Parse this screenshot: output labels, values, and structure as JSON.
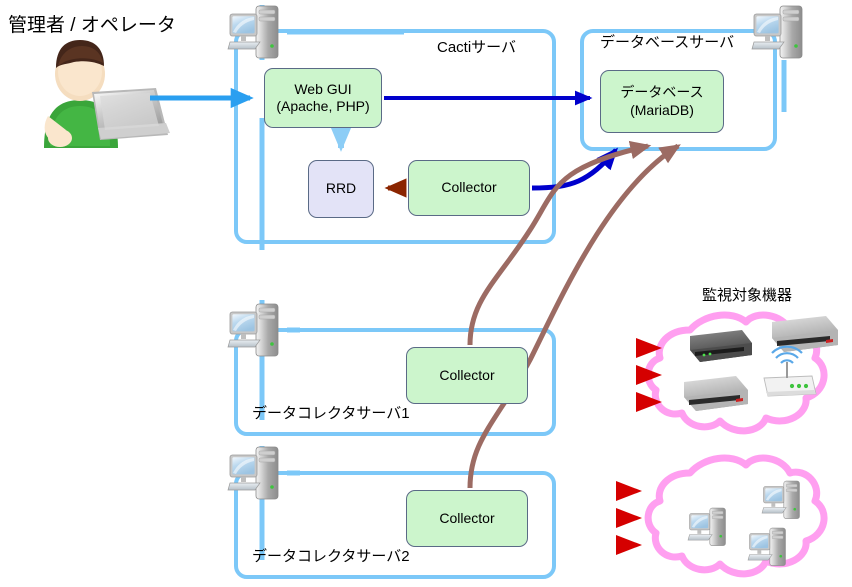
{
  "diagram": {
    "title_operator": "管理者 / オペレータ",
    "colors": {
      "frame_blue": "#7cc8f8",
      "node_green": "#ccf5cc",
      "node_lavender": "#e3e3f7",
      "node_border": "#5a6a86",
      "arrow_blue": "#0000cc",
      "arrow_brown": "#9c6b63",
      "arrow_darkred": "#8b2500",
      "arrow_red": "#e01b00",
      "arrow_lightblue": "#2a9ff0",
      "cloud_pink": "#ff9ff0",
      "person_shirt": "#3aa53a",
      "person_hair": "#4a2a18"
    }
  },
  "zones": {
    "cacti_server": {
      "label": "Cactiサーバ",
      "nodes": [
        {
          "id": "webgui",
          "line1": "Web GUI",
          "line2": "(Apache, PHP)",
          "fill": "green"
        },
        {
          "id": "rrd",
          "line1": "RRD",
          "line2": "",
          "fill": "lavender"
        },
        {
          "id": "collector",
          "line1": "Collector",
          "line2": "",
          "fill": "green"
        }
      ]
    },
    "database_server": {
      "label": "データベースサーバ",
      "nodes": [
        {
          "id": "database",
          "line1": "データベース",
          "line2": "(MariaDB)",
          "fill": "green"
        }
      ]
    },
    "data_collector_server_1": {
      "label": "データコレクタサーバ1",
      "nodes": [
        {
          "id": "collector1",
          "line1": "Collector",
          "line2": "",
          "fill": "green"
        }
      ]
    },
    "data_collector_server_2": {
      "label": "データコレクタサーバ2",
      "nodes": [
        {
          "id": "collector2",
          "line1": "Collector",
          "line2": "",
          "fill": "green"
        }
      ]
    },
    "monitored_devices": {
      "label": "監視対象機器",
      "cloud_top_contents": [
        "network-switch-dark",
        "network-switch-light",
        "network-switch-light",
        "wireless-access-point"
      ],
      "cloud_bottom_contents": [
        "computer-workstation",
        "computer-workstation",
        "computer-workstation"
      ]
    }
  },
  "icons": {
    "operator": "person-with-laptop-icon",
    "computer_cacti": "computer-icon",
    "computer_db": "computer-icon",
    "computer_dcs1": "computer-icon",
    "computer_dcs2": "computer-icon"
  },
  "flows": [
    {
      "from": "operator",
      "to": "webgui",
      "color": "#2a9ff0",
      "style": "straight"
    },
    {
      "from": "webgui",
      "to": "database",
      "color": "#0000cc",
      "style": "straight"
    },
    {
      "from": "webgui",
      "to": "rrd",
      "color": "#7cc8f8",
      "style": "straight-down"
    },
    {
      "from": "collector",
      "to": "rrd",
      "color": "#8b2500",
      "style": "straight-left"
    },
    {
      "from": "collector",
      "to": "database",
      "color": "#0000cc",
      "style": "curved-up"
    },
    {
      "from": "collector1",
      "to": "database",
      "color": "#9c6b63",
      "style": "curved-up"
    },
    {
      "from": "collector2",
      "to": "database",
      "color": "#9c6b63",
      "style": "curved-up"
    },
    {
      "from": "collector1",
      "to": "monitored_devices_top",
      "color": "#e01b00",
      "style": "triple-arrow"
    },
    {
      "from": "collector2",
      "to": "monitored_devices_bottom",
      "color": "#e01b00",
      "style": "triple-arrow"
    }
  ]
}
